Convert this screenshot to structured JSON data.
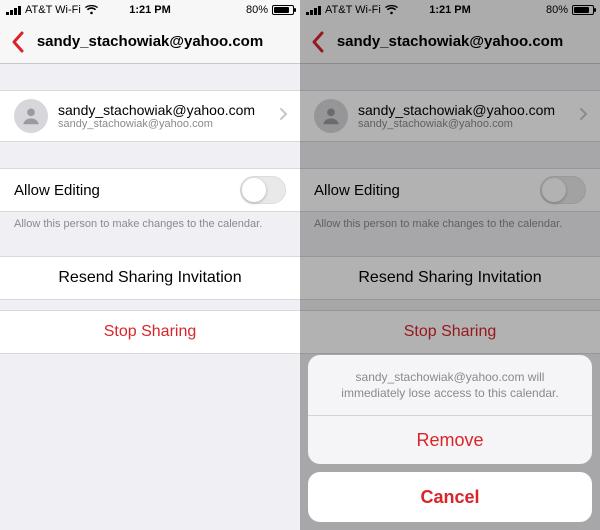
{
  "status": {
    "carrier": "AT&T Wi-Fi",
    "time": "1:21 PM",
    "battery_pct": "80%"
  },
  "nav": {
    "title": "sandy_stachowiak@yahoo.com"
  },
  "person": {
    "name": "sandy_stachowiak@yahoo.com",
    "sub": "sandy_stachowiak@yahoo.com"
  },
  "editing": {
    "label": "Allow Editing",
    "hint": "Allow this person to make changes to the calendar.",
    "on": false
  },
  "actions": {
    "resend": "Resend Sharing Invitation",
    "stop": "Stop Sharing"
  },
  "sheet": {
    "message": "sandy_stachowiak@yahoo.com will immediately lose access to this calendar.",
    "remove": "Remove",
    "cancel": "Cancel"
  }
}
